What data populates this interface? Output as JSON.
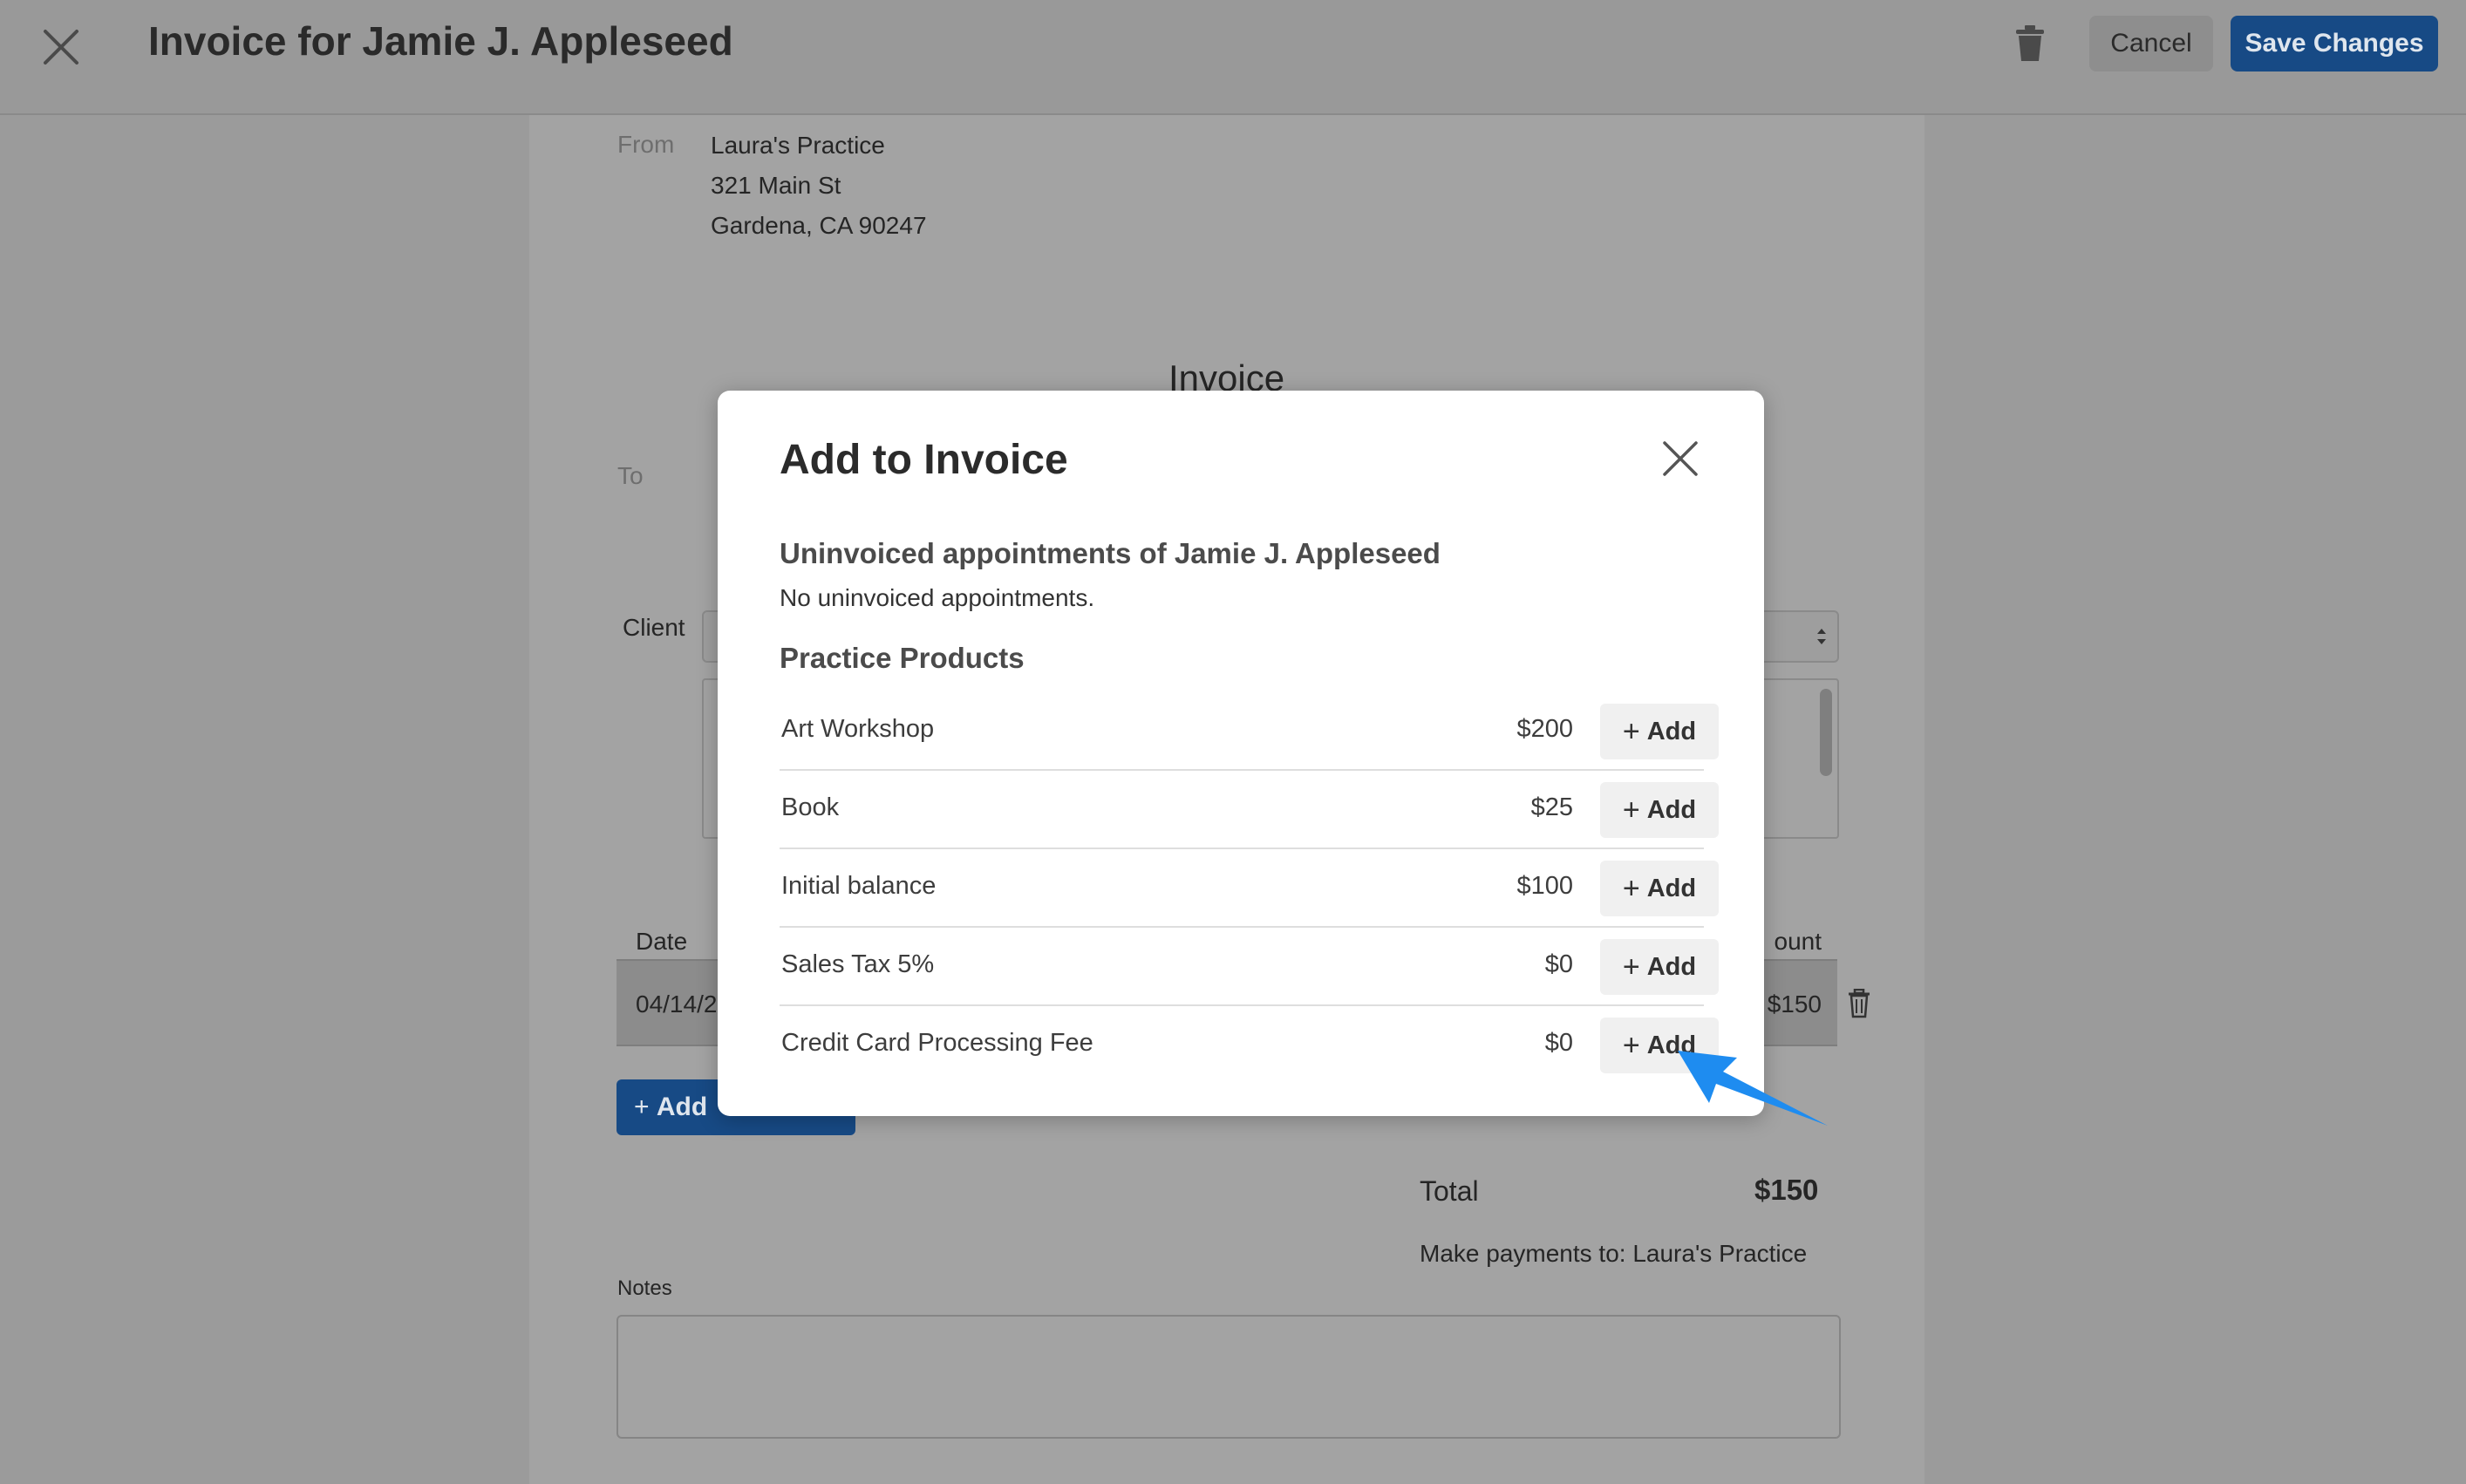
{
  "header": {
    "title": "Invoice for Jamie J. Appleseed",
    "cancel_label": "Cancel",
    "save_label": "Save Changes"
  },
  "invoice": {
    "from_label": "From",
    "from_lines": [
      "Laura's Practice",
      "321 Main St",
      "Gardena, CA 90247"
    ],
    "heading": "Invoice",
    "to_label": "To",
    "client_label": "Client",
    "table_headers": {
      "date": "Date",
      "amount": "ount"
    },
    "row": {
      "date": "04/14/2",
      "amount": "$150"
    },
    "add_line_label": "Add",
    "total_label": "Total",
    "total_value": "$150",
    "payment_note": "Make payments to: Laura's Practice",
    "notes_label": "Notes"
  },
  "modal": {
    "title": "Add to Invoice",
    "appointments_heading": "Uninvoiced appointments of Jamie J. Appleseed",
    "appointments_note": "No uninvoiced appointments.",
    "products_heading": "Practice Products",
    "add_label": "Add",
    "products": [
      {
        "name": "Art Workshop",
        "price": "$200"
      },
      {
        "name": "Book",
        "price": "$25"
      },
      {
        "name": "Initial balance",
        "price": "$100"
      },
      {
        "name": "Sales Tax 5%",
        "price": "$0"
      },
      {
        "name": "Credit Card Processing Fee",
        "price": "$0"
      }
    ]
  },
  "colors": {
    "primary_button": "#174a85",
    "overlay": "#9b9b9b",
    "pointer_arrow": "#1e8cf0"
  },
  "icons": [
    "close-icon",
    "trash-icon",
    "plus-icon",
    "select-arrows-icon",
    "pointer-arrow-icon"
  ]
}
